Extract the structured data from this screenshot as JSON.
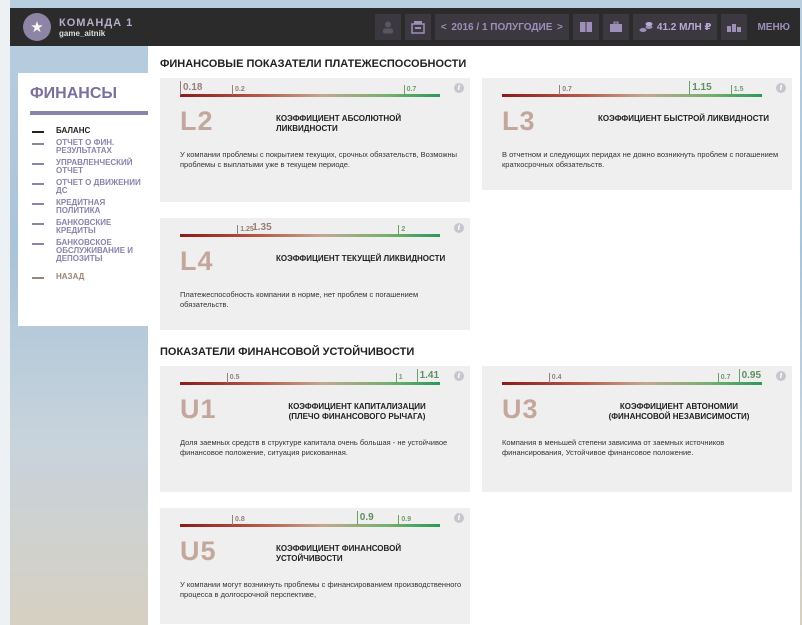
{
  "topbar": {
    "team_name": "КОМАНДА 1",
    "username": "game_aitnik",
    "period_label": "2016 / 1 ПОЛУГОДИЕ",
    "prev_arrow": "<",
    "next_arrow": ">",
    "money": "41.2 МЛН ₽",
    "menu_label": "МЕНЮ"
  },
  "sidebar": {
    "title": "ФИНАНСЫ",
    "items": [
      {
        "label": "БАЛАНС"
      },
      {
        "label": "ОТЧЕТ О ФИН. РЕЗУЛЬТАТАХ"
      },
      {
        "label": "УПРАВЛЕНЧЕСКИЙ ОТЧЕТ"
      },
      {
        "label": "ОТЧЕТ О ДВИЖЕНИИ ДС"
      },
      {
        "label": "КРЕДИТНАЯ ПОЛИТИКА"
      },
      {
        "label": "БАНКОВСКИЕ КРЕДИТЫ"
      },
      {
        "label": "БАНКОВСКОЕ ОБСЛУЖИВАНИЕ И ДЕПОЗИТЫ"
      }
    ],
    "back_label": "НАЗАД"
  },
  "sections": {
    "solvency_title": "ФИНАНСОВЫЕ ПОКАЗАТЕЛИ ПЛАТЕЖЕСПОСОБНОСТИ",
    "stability_title": "ПОКАЗАТЕЛИ ФИНАНСОВОЙ УСТОЙЧИВОСТИ"
  },
  "cards": {
    "l2": {
      "code": "L2",
      "name": "КОЭФФИЦИЕНТ АБСОЛЮТНОЙ ЛИКВИДНОСТИ",
      "description": "У компании проблемы с покрытием текущих, срочных обязательств, Возможны проблемы с выплатыми уже в текущем периоде.",
      "value": "0.18",
      "min": "0.2",
      "max": "0.7"
    },
    "l3": {
      "code": "L3",
      "name": "КОЭФФИЦИЕНТ БЫСТРОЙ ЛИКВИДНОСТИ",
      "description": "В отчетном и следующих перидах не дожно возникнуть проблем с погашением краткосрочных обязательств.",
      "value": "1.15",
      "min": "0.7",
      "max": "1.5"
    },
    "l4": {
      "code": "L4",
      "name": "КОЭФФИЦИЕНТ ТЕКУЩЕЙ ЛИКВИДНОСТИ",
      "description": "Платежеспособность компании в норме, нет проблем с погашением обязательств.",
      "value": "1.35",
      "min": "1.25",
      "max": "2"
    },
    "u1": {
      "code": "U1",
      "name": "КОЭФФИЦИЕНТ КАПИТАЛИЗАЦИИ (ПЛЕЧО ФИНАНСОВОГО РЫЧАГА)",
      "description": "Доля заемных средств в структуре капитала очень большая - не устойчивое финансовое положение, ситуация рискованная.",
      "value": "1.41",
      "min": "0.5",
      "max": "1"
    },
    "u3": {
      "code": "U3",
      "name": "КОЭФФИЦИЕНТ АВТОНОМИИ (ФИНАНСОВОЙ НЕЗАВИСИМОСТИ)",
      "description": "Компания в меньшей степени зависима от заемных источников финансирования, Устойчивое финансовое положение.",
      "value": "0.95",
      "min": "0.4",
      "max": "0.7"
    },
    "u5": {
      "code": "U5",
      "name": "КОЭФФИЦИЕНТ ФИНАНСОВОЙ УСТОЙЧИВОСТИ",
      "description": "У компании могут возникнуть проблемы с финансированием производственного процесса в долгосрочной перспективе,",
      "value": "0.9",
      "min": "0.8",
      "max": "0.9"
    }
  },
  "info_glyph": "i",
  "colors": {
    "topbar_bg": "#2b2b2b",
    "accent_purple": "#8c83ab",
    "code_color": "#c4a79c",
    "card_bg": "#efefef"
  }
}
